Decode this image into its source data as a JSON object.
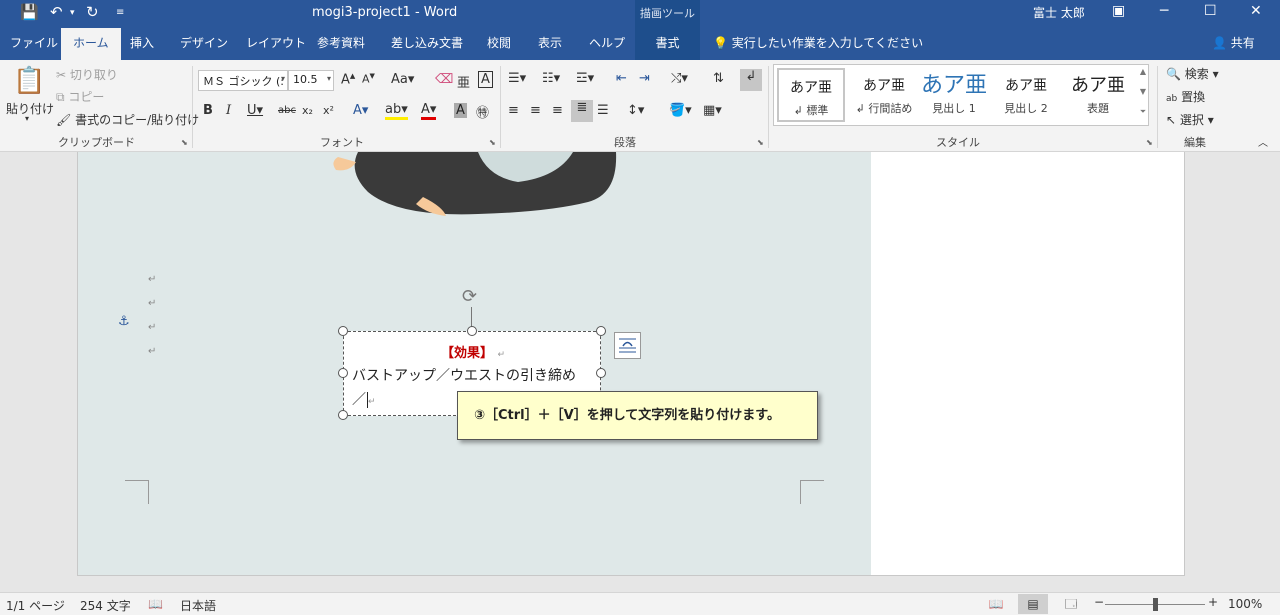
{
  "titlebar": {
    "document_title": "mogi3-project1  -  Word",
    "context_group": "描画ツール",
    "user_name": "富士 太郎",
    "save_icon": "save-icon",
    "undo_icon": "undo-icon",
    "redo_icon": "redo-icon"
  },
  "tabs": {
    "file": "ファイル",
    "home": "ホーム",
    "insert": "挿入",
    "design": "デザイン",
    "layout": "レイアウト",
    "references": "参考資料",
    "mailings": "差し込み文書",
    "review": "校閲",
    "view": "表示",
    "help": "ヘルプ",
    "format": "書式",
    "tell_me": "実行したい作業を入力してください",
    "share": "共有"
  },
  "ribbon": {
    "clipboard": {
      "label": "クリップボード",
      "paste": "貼り付け",
      "cut": "切り取り",
      "copy": "コピー",
      "format_painter": "書式のコピー/貼り付け"
    },
    "font": {
      "label": "フォント",
      "font_name": "ＭＳ ゴシック (:",
      "font_size": "10.5"
    },
    "paragraph": {
      "label": "段落"
    },
    "styles": {
      "label": "スタイル",
      "items": [
        {
          "sample": "あア亜",
          "name": "↲ 標準"
        },
        {
          "sample": "あア亜",
          "name": "↲ 行間詰め"
        },
        {
          "sample": "あア亜",
          "name": "見出し 1"
        },
        {
          "sample": "あア亜",
          "name": "見出し 2"
        },
        {
          "sample": "あア亜",
          "name": "表題"
        }
      ]
    },
    "editing": {
      "label": "編集",
      "find": "検索",
      "replace": "置換",
      "select": "選択"
    }
  },
  "document": {
    "textbox": {
      "heading": "【効果】",
      "line1": "バストアップ／ウエストの引き締め",
      "line2": "／"
    },
    "callout": "③［Ctrl］＋［V］を押して文字列を貼り付けます。"
  },
  "statusbar": {
    "page": "1/1 ページ",
    "words": "254 文字",
    "language": "日本語",
    "zoom": "100%"
  },
  "colors": {
    "word_blue": "#2b579a",
    "heading_red": "#c00000",
    "callout_yellow": "#ffffcc"
  }
}
